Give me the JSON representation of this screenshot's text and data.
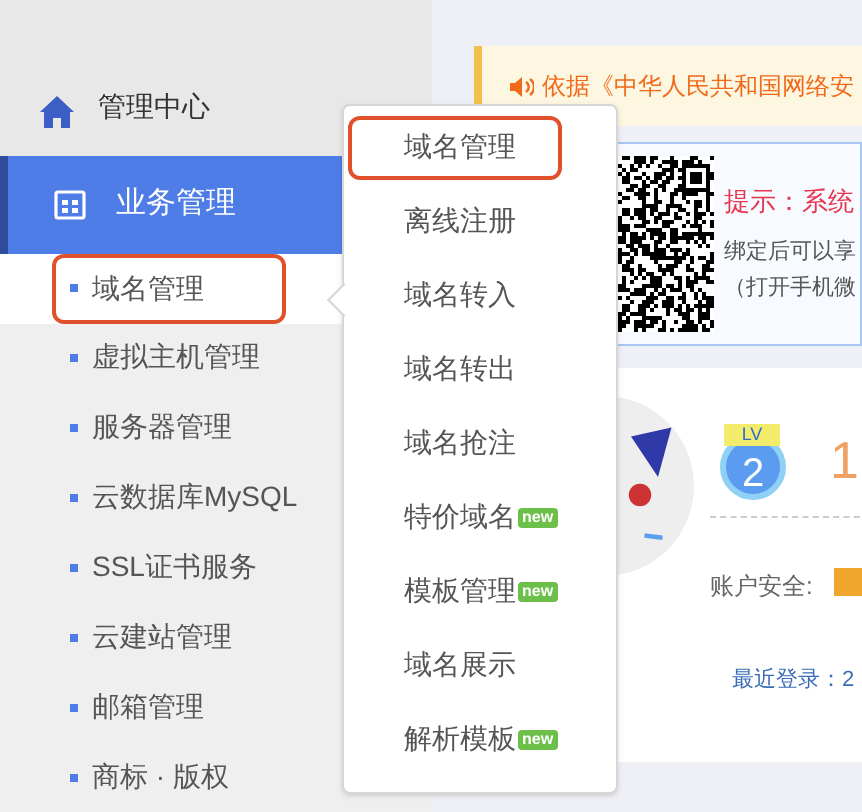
{
  "sidebar": {
    "home": {
      "label": "管理中心"
    },
    "section": {
      "label": "业务管理",
      "selected": true
    },
    "items": [
      {
        "label": "域名管理",
        "selected": true
      },
      {
        "label": "虚拟主机管理",
        "selected": false
      },
      {
        "label": "服务器管理",
        "selected": false
      },
      {
        "label": "云数据库MySQL",
        "selected": false
      },
      {
        "label": "SSL证书服务",
        "selected": false
      },
      {
        "label": "云建站管理",
        "selected": false
      },
      {
        "label": "邮箱管理",
        "selected": false
      },
      {
        "label": "商标 · 版权",
        "selected": false
      }
    ]
  },
  "popup": {
    "items": [
      {
        "label": "域名管理",
        "selected": true
      },
      {
        "label": "离线注册",
        "selected": false
      },
      {
        "label": "域名转入",
        "selected": false
      },
      {
        "label": "域名转出",
        "selected": false
      },
      {
        "label": "域名抢注",
        "selected": false
      },
      {
        "label": "特价域名",
        "selected": false,
        "badge": "new"
      },
      {
        "label": "模板管理",
        "selected": false,
        "badge": "new"
      },
      {
        "label": "域名展示",
        "selected": false
      },
      {
        "label": "解析模板",
        "selected": false,
        "badge": "new"
      }
    ]
  },
  "notice": {
    "text": "依据《中华人民共和国网络安"
  },
  "tip_card": {
    "title": "提示：系统",
    "lines": [
      "绑定后可以享",
      "（打开手机微"
    ]
  },
  "account": {
    "level_label": "LV",
    "level_number": "2",
    "name": "1",
    "security_label": "账户安全:",
    "last_login": "最近登录：2"
  }
}
